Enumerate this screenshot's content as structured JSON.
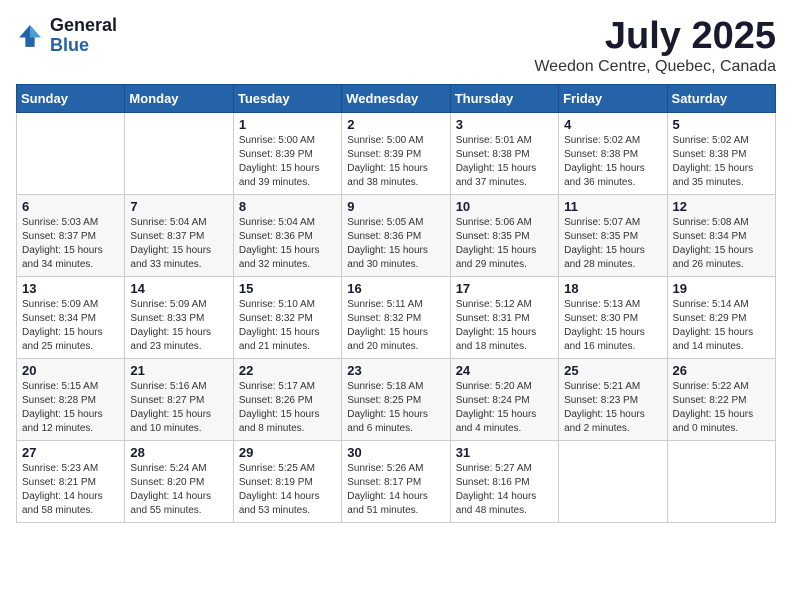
{
  "logo": {
    "general": "General",
    "blue": "Blue"
  },
  "title": "July 2025",
  "subtitle": "Weedon Centre, Quebec, Canada",
  "weekdays": [
    "Sunday",
    "Monday",
    "Tuesday",
    "Wednesday",
    "Thursday",
    "Friday",
    "Saturday"
  ],
  "weeks": [
    [
      null,
      null,
      {
        "day": 1,
        "sunrise": "5:00 AM",
        "sunset": "8:39 PM",
        "daylight": "15 hours and 39 minutes."
      },
      {
        "day": 2,
        "sunrise": "5:00 AM",
        "sunset": "8:39 PM",
        "daylight": "15 hours and 38 minutes."
      },
      {
        "day": 3,
        "sunrise": "5:01 AM",
        "sunset": "8:38 PM",
        "daylight": "15 hours and 37 minutes."
      },
      {
        "day": 4,
        "sunrise": "5:02 AM",
        "sunset": "8:38 PM",
        "daylight": "15 hours and 36 minutes."
      },
      {
        "day": 5,
        "sunrise": "5:02 AM",
        "sunset": "8:38 PM",
        "daylight": "15 hours and 35 minutes."
      }
    ],
    [
      {
        "day": 6,
        "sunrise": "5:03 AM",
        "sunset": "8:37 PM",
        "daylight": "15 hours and 34 minutes."
      },
      {
        "day": 7,
        "sunrise": "5:04 AM",
        "sunset": "8:37 PM",
        "daylight": "15 hours and 33 minutes."
      },
      {
        "day": 8,
        "sunrise": "5:04 AM",
        "sunset": "8:36 PM",
        "daylight": "15 hours and 32 minutes."
      },
      {
        "day": 9,
        "sunrise": "5:05 AM",
        "sunset": "8:36 PM",
        "daylight": "15 hours and 30 minutes."
      },
      {
        "day": 10,
        "sunrise": "5:06 AM",
        "sunset": "8:35 PM",
        "daylight": "15 hours and 29 minutes."
      },
      {
        "day": 11,
        "sunrise": "5:07 AM",
        "sunset": "8:35 PM",
        "daylight": "15 hours and 28 minutes."
      },
      {
        "day": 12,
        "sunrise": "5:08 AM",
        "sunset": "8:34 PM",
        "daylight": "15 hours and 26 minutes."
      }
    ],
    [
      {
        "day": 13,
        "sunrise": "5:09 AM",
        "sunset": "8:34 PM",
        "daylight": "15 hours and 25 minutes."
      },
      {
        "day": 14,
        "sunrise": "5:09 AM",
        "sunset": "8:33 PM",
        "daylight": "15 hours and 23 minutes."
      },
      {
        "day": 15,
        "sunrise": "5:10 AM",
        "sunset": "8:32 PM",
        "daylight": "15 hours and 21 minutes."
      },
      {
        "day": 16,
        "sunrise": "5:11 AM",
        "sunset": "8:32 PM",
        "daylight": "15 hours and 20 minutes."
      },
      {
        "day": 17,
        "sunrise": "5:12 AM",
        "sunset": "8:31 PM",
        "daylight": "15 hours and 18 minutes."
      },
      {
        "day": 18,
        "sunrise": "5:13 AM",
        "sunset": "8:30 PM",
        "daylight": "15 hours and 16 minutes."
      },
      {
        "day": 19,
        "sunrise": "5:14 AM",
        "sunset": "8:29 PM",
        "daylight": "15 hours and 14 minutes."
      }
    ],
    [
      {
        "day": 20,
        "sunrise": "5:15 AM",
        "sunset": "8:28 PM",
        "daylight": "15 hours and 12 minutes."
      },
      {
        "day": 21,
        "sunrise": "5:16 AM",
        "sunset": "8:27 PM",
        "daylight": "15 hours and 10 minutes."
      },
      {
        "day": 22,
        "sunrise": "5:17 AM",
        "sunset": "8:26 PM",
        "daylight": "15 hours and 8 minutes."
      },
      {
        "day": 23,
        "sunrise": "5:18 AM",
        "sunset": "8:25 PM",
        "daylight": "15 hours and 6 minutes."
      },
      {
        "day": 24,
        "sunrise": "5:20 AM",
        "sunset": "8:24 PM",
        "daylight": "15 hours and 4 minutes."
      },
      {
        "day": 25,
        "sunrise": "5:21 AM",
        "sunset": "8:23 PM",
        "daylight": "15 hours and 2 minutes."
      },
      {
        "day": 26,
        "sunrise": "5:22 AM",
        "sunset": "8:22 PM",
        "daylight": "15 hours and 0 minutes."
      }
    ],
    [
      {
        "day": 27,
        "sunrise": "5:23 AM",
        "sunset": "8:21 PM",
        "daylight": "14 hours and 58 minutes."
      },
      {
        "day": 28,
        "sunrise": "5:24 AM",
        "sunset": "8:20 PM",
        "daylight": "14 hours and 55 minutes."
      },
      {
        "day": 29,
        "sunrise": "5:25 AM",
        "sunset": "8:19 PM",
        "daylight": "14 hours and 53 minutes."
      },
      {
        "day": 30,
        "sunrise": "5:26 AM",
        "sunset": "8:17 PM",
        "daylight": "14 hours and 51 minutes."
      },
      {
        "day": 31,
        "sunrise": "5:27 AM",
        "sunset": "8:16 PM",
        "daylight": "14 hours and 48 minutes."
      },
      null,
      null
    ]
  ]
}
